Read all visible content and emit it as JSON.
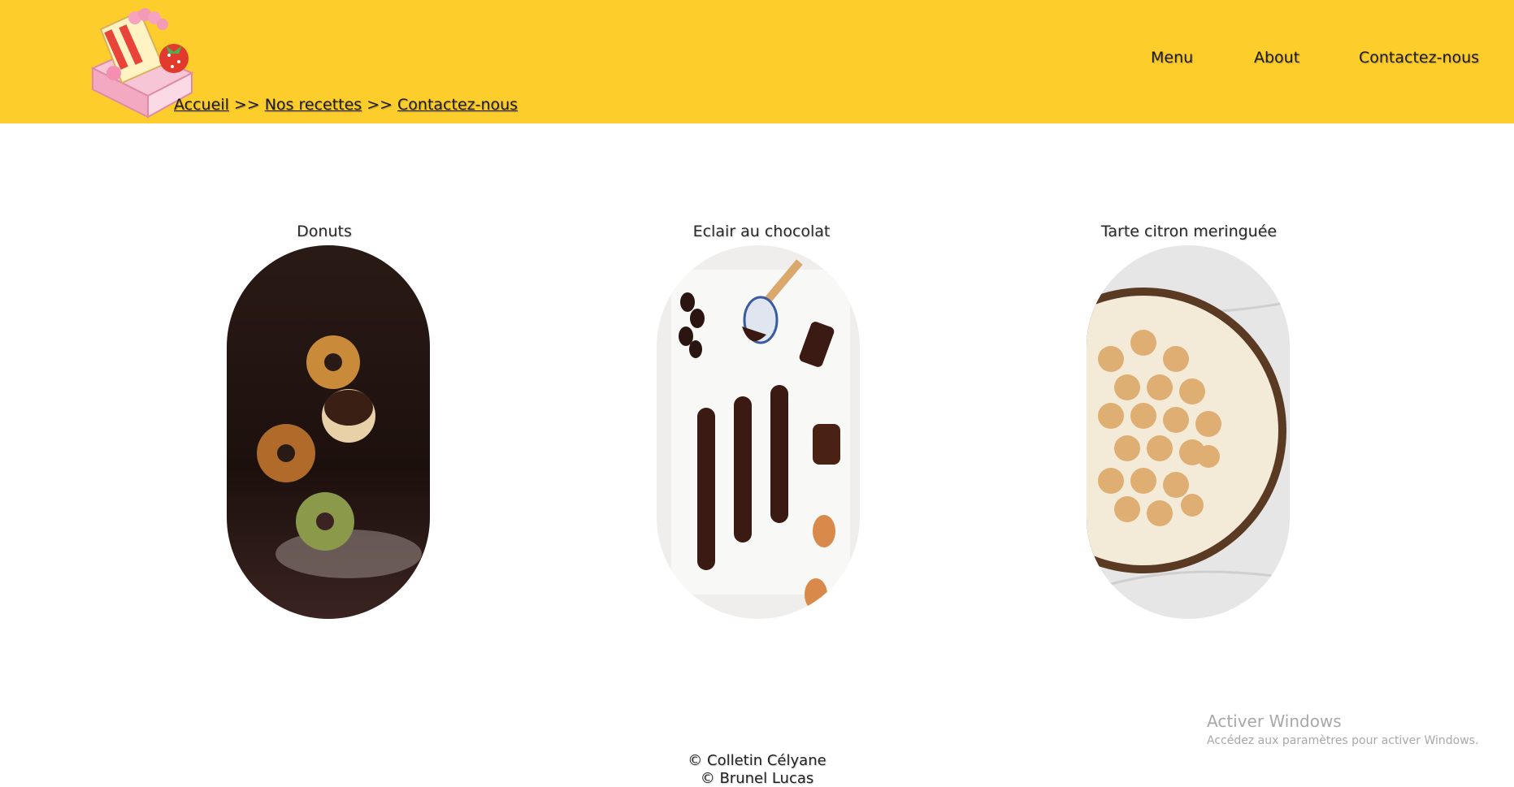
{
  "header": {
    "logo_icon": "cake-box-logo",
    "background": "#fdcd2c",
    "breadcrumb": {
      "items": [
        "Accueil",
        "Nos recettes",
        "Contactez-nous"
      ],
      "separator": ">>"
    },
    "nav": [
      "Menu",
      "About",
      "Contactez-nous"
    ]
  },
  "recipes": [
    {
      "title": "Donuts",
      "image": "donuts-photo"
    },
    {
      "title": "Eclair au chocolat",
      "image": "eclairs-photo"
    },
    {
      "title": "Tarte citron meringuée",
      "image": "lemon-meringue-tart-photo"
    }
  ],
  "watermark": {
    "title": "Activer Windows",
    "subtitle": "Accédez aux paramètres pour activer Windows."
  },
  "footer": {
    "line1": "© Colletin Célyane",
    "line2": "© Brunel Lucas"
  }
}
